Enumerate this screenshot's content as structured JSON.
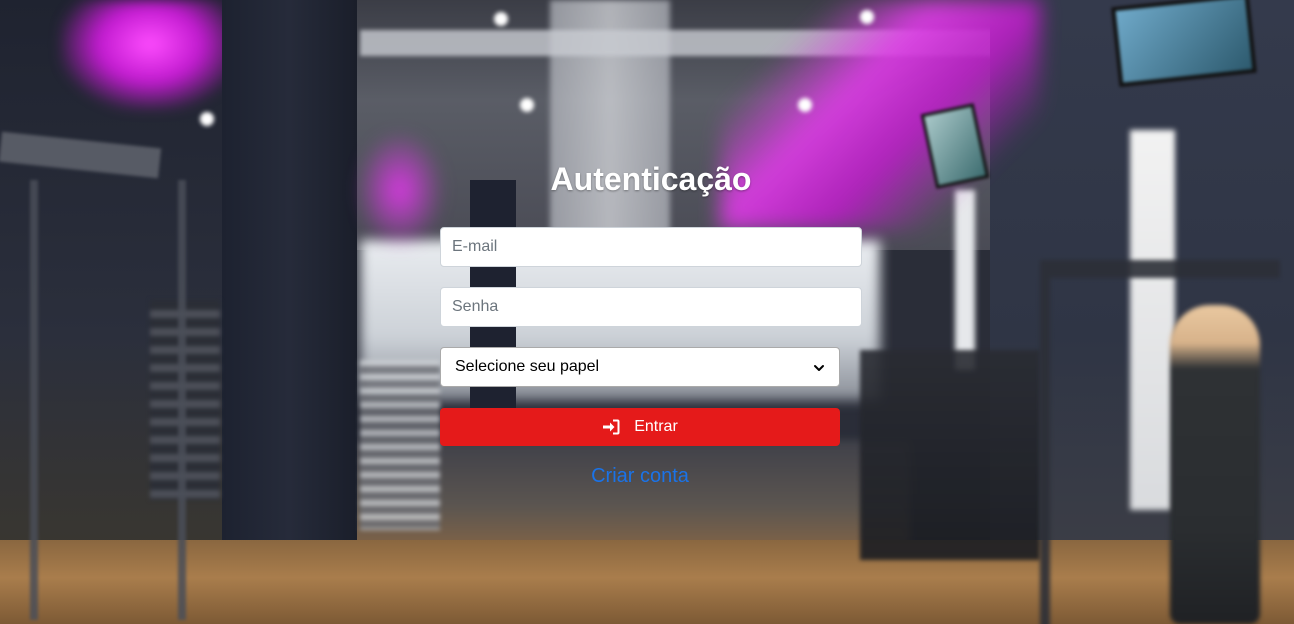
{
  "auth": {
    "title": "Autenticação",
    "email_placeholder": "E-mail",
    "password_placeholder": "Senha",
    "role_select_value": "Selecione seu papel",
    "enter_label": "Entrar",
    "create_account_label": "Criar conta"
  },
  "icons": {
    "enter": "sign-in-icon",
    "select_arrow": "chevron-down-icon"
  },
  "colors": {
    "primary_button": "#e51a1a",
    "link": "#1a73e8",
    "title": "#ffffff"
  }
}
